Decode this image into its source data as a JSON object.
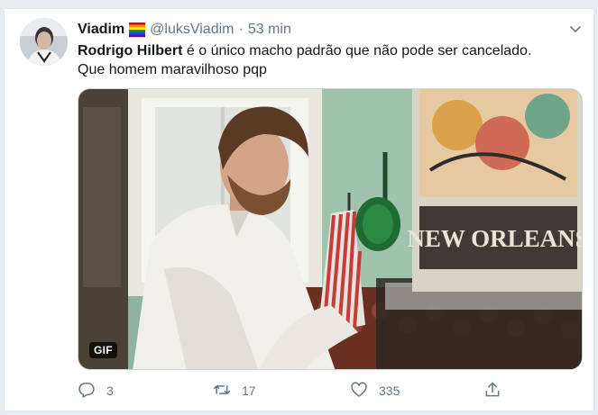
{
  "tweet": {
    "author_name": "Viadim",
    "author_handle": "@luksViadim",
    "separator": "·",
    "timestamp": "53 min",
    "text_mention": "Rodrigo Hilbert",
    "text_rest_line1": " é o único macho padrão que não pode ser cancelado.",
    "text_line2": "Que homem maravilhoso pqp",
    "media_badge": "GIF",
    "media_sign": "NEW ORLEANS"
  },
  "actions": {
    "reply_count": "3",
    "retweet_count": "17",
    "like_count": "335"
  },
  "colors": {
    "text_primary": "#14171a",
    "text_secondary": "#657786",
    "background": "#e6ecf0",
    "card": "#ffffff"
  },
  "icons": [
    "avatar",
    "rainbow-flag-icon",
    "chevron-down-icon",
    "reply-icon",
    "retweet-icon",
    "like-icon",
    "share-icon"
  ]
}
